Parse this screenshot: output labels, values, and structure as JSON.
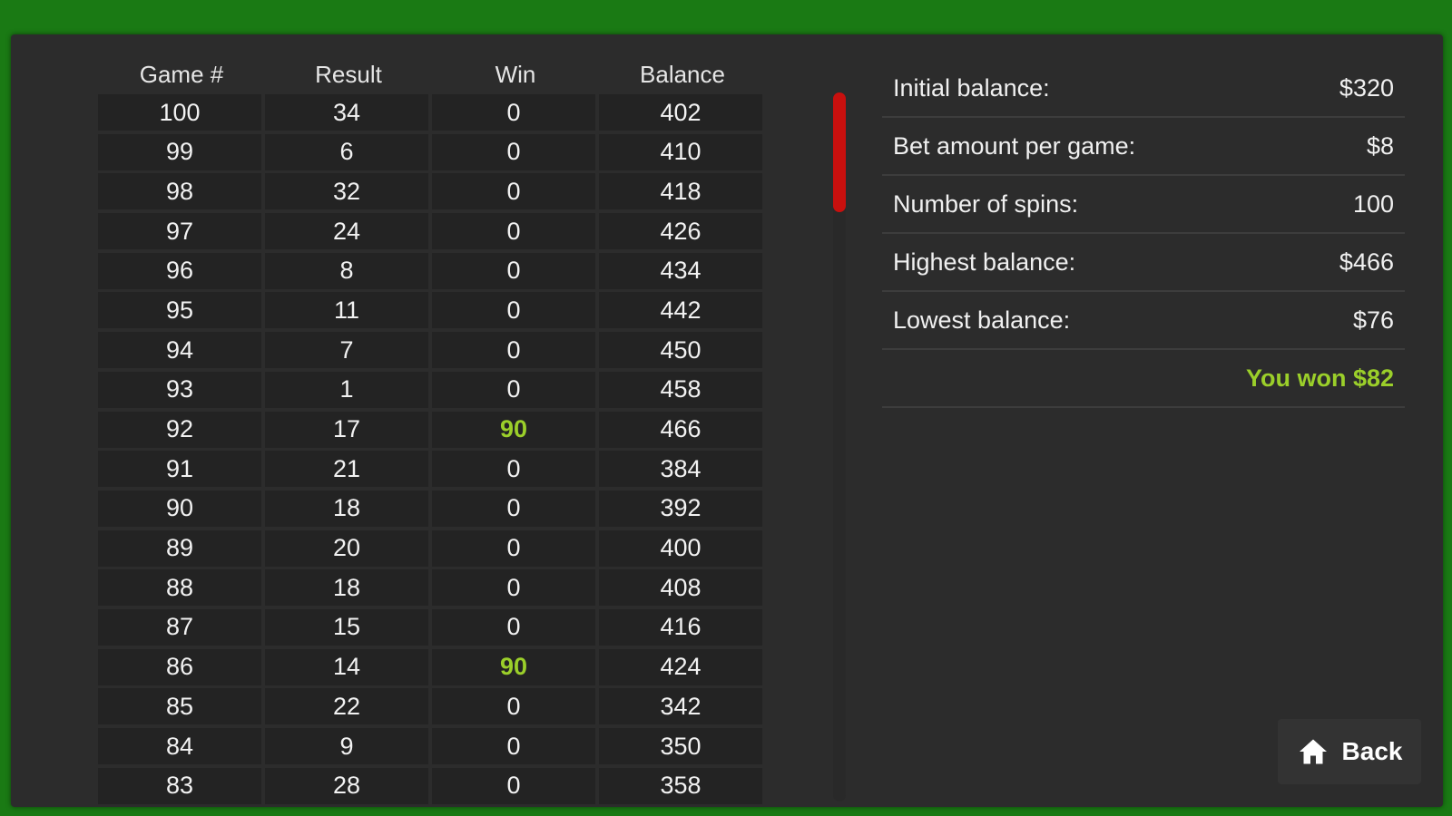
{
  "table": {
    "headers": [
      "Game #",
      "Result",
      "Win",
      "Balance"
    ],
    "rows": [
      {
        "game": "100",
        "result": "34",
        "win": "0",
        "balance": "402"
      },
      {
        "game": "99",
        "result": "6",
        "win": "0",
        "balance": "410"
      },
      {
        "game": "98",
        "result": "32",
        "win": "0",
        "balance": "418"
      },
      {
        "game": "97",
        "result": "24",
        "win": "0",
        "balance": "426"
      },
      {
        "game": "96",
        "result": "8",
        "win": "0",
        "balance": "434"
      },
      {
        "game": "95",
        "result": "11",
        "win": "0",
        "balance": "442"
      },
      {
        "game": "94",
        "result": "7",
        "win": "0",
        "balance": "450"
      },
      {
        "game": "93",
        "result": "1",
        "win": "0",
        "balance": "458"
      },
      {
        "game": "92",
        "result": "17",
        "win": "90",
        "balance": "466"
      },
      {
        "game": "91",
        "result": "21",
        "win": "0",
        "balance": "384"
      },
      {
        "game": "90",
        "result": "18",
        "win": "0",
        "balance": "392"
      },
      {
        "game": "89",
        "result": "20",
        "win": "0",
        "balance": "400"
      },
      {
        "game": "88",
        "result": "18",
        "win": "0",
        "balance": "408"
      },
      {
        "game": "87",
        "result": "15",
        "win": "0",
        "balance": "416"
      },
      {
        "game": "86",
        "result": "14",
        "win": "90",
        "balance": "424"
      },
      {
        "game": "85",
        "result": "22",
        "win": "0",
        "balance": "342"
      },
      {
        "game": "84",
        "result": "9",
        "win": "0",
        "balance": "350"
      },
      {
        "game": "83",
        "result": "28",
        "win": "0",
        "balance": "358"
      }
    ]
  },
  "stats": {
    "initial_balance_label": "Initial balance:",
    "initial_balance_value": "$320",
    "bet_label": "Bet amount per game:",
    "bet_value": "$8",
    "spins_label": "Number of spins:",
    "spins_value": "100",
    "highest_label": "Highest balance:",
    "highest_value": "$466",
    "lowest_label": "Lowest balance:",
    "lowest_value": "$76",
    "result_text": "You won $82"
  },
  "back_button": {
    "label": "Back",
    "icon": "home-icon"
  },
  "colors": {
    "background": "#1a7a14",
    "panel": "#2c2c2c",
    "win_highlight": "#9bcf2a",
    "scroll_thumb": "#c8100e"
  }
}
